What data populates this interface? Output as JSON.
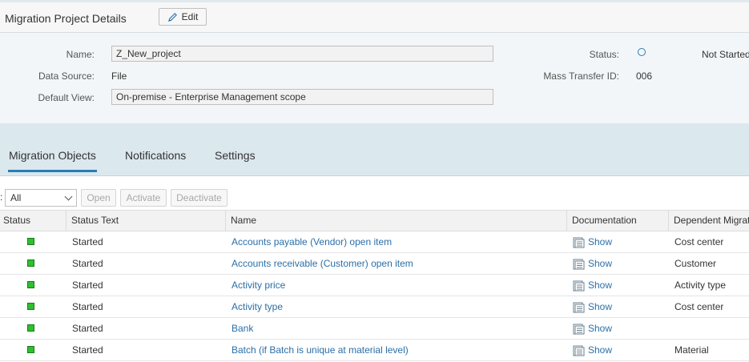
{
  "header": {
    "title": "Migration Project Details",
    "edit_label": "Edit"
  },
  "details": {
    "name_label": "Name:",
    "name_value": "Z_New_project",
    "data_source_label": "Data Source:",
    "data_source_value": "File",
    "default_view_label": "Default View:",
    "default_view_value": "On-premise - Enterprise Management scope",
    "status_label": "Status:",
    "status_value": "Not Started",
    "mass_transfer_label": "Mass Transfer ID:",
    "mass_transfer_value": "006"
  },
  "tabs": [
    {
      "label": "Migration Objects",
      "selected": true
    },
    {
      "label": "Notifications",
      "selected": false
    },
    {
      "label": "Settings",
      "selected": false
    }
  ],
  "toolbar": {
    "filter_colon": ":",
    "filter_value": "All",
    "open_label": "Open",
    "activate_label": "Activate",
    "deactivate_label": "Deactivate"
  },
  "table": {
    "columns": [
      "Status",
      "Status Text",
      "Name",
      "Documentation",
      "Dependent Migration Objects"
    ],
    "rows": [
      {
        "status": "green",
        "status_text": "Started",
        "name": "Accounts payable (Vendor) open item",
        "doc": "Show",
        "dependent": "Cost center"
      },
      {
        "status": "green",
        "status_text": "Started",
        "name": "Accounts receivable (Customer) open item",
        "doc": "Show",
        "dependent": "Customer"
      },
      {
        "status": "green",
        "status_text": "Started",
        "name": "Activity price",
        "doc": "Show",
        "dependent": "Activity type"
      },
      {
        "status": "green",
        "status_text": "Started",
        "name": "Activity type",
        "doc": "Show",
        "dependent": "Cost center"
      },
      {
        "status": "green",
        "status_text": "Started",
        "name": "Bank",
        "doc": "Show",
        "dependent": ""
      },
      {
        "status": "green",
        "status_text": "Started",
        "name": "Batch (if Batch is unique at material level)",
        "doc": "Show",
        "dependent": "Material"
      }
    ]
  },
  "colors": {
    "accent": "#2b7cb5",
    "status_green": "#2ec02e",
    "link": "#2b6fa8"
  }
}
